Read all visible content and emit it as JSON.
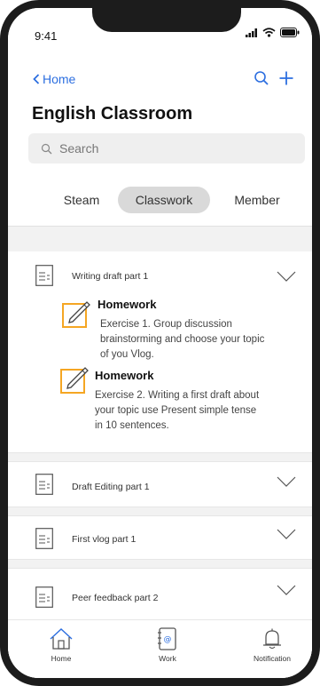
{
  "status": {
    "time": "9:41"
  },
  "nav": {
    "back_label": "Home"
  },
  "page": {
    "title": "English Classroom"
  },
  "search": {
    "placeholder": "Search"
  },
  "tabs": [
    {
      "label": "Steam",
      "active": false
    },
    {
      "label": "Classwork",
      "active": true
    },
    {
      "label": "Member",
      "active": false
    }
  ],
  "sections": [
    {
      "title": "Writing draft  part 1",
      "expanded": true,
      "items": [
        {
          "title": "Homework",
          "text_lines": [
            "Exercise 1. Group discussion",
            "brainstorming and choose your topic",
            "of you Vlog."
          ]
        },
        {
          "title": "Homework",
          "text_lines": [
            "Exercise 2. Writing a first draft about",
            "your topic use Present simple tense",
            "in 10 sentences."
          ]
        }
      ]
    },
    {
      "title": "Draft Editing part 1",
      "expanded": false
    },
    {
      "title": "First vlog part 1",
      "expanded": false
    },
    {
      "title": "Peer feedback part 2",
      "expanded": false
    }
  ],
  "bottom_nav": [
    {
      "label": "Home",
      "icon": "home-icon"
    },
    {
      "label": "Work",
      "icon": "work-icon"
    },
    {
      "label": "Notification",
      "icon": "bell-icon"
    }
  ],
  "colors": {
    "accent": "#2d6fe0",
    "homework_icon": "#f5a623"
  }
}
